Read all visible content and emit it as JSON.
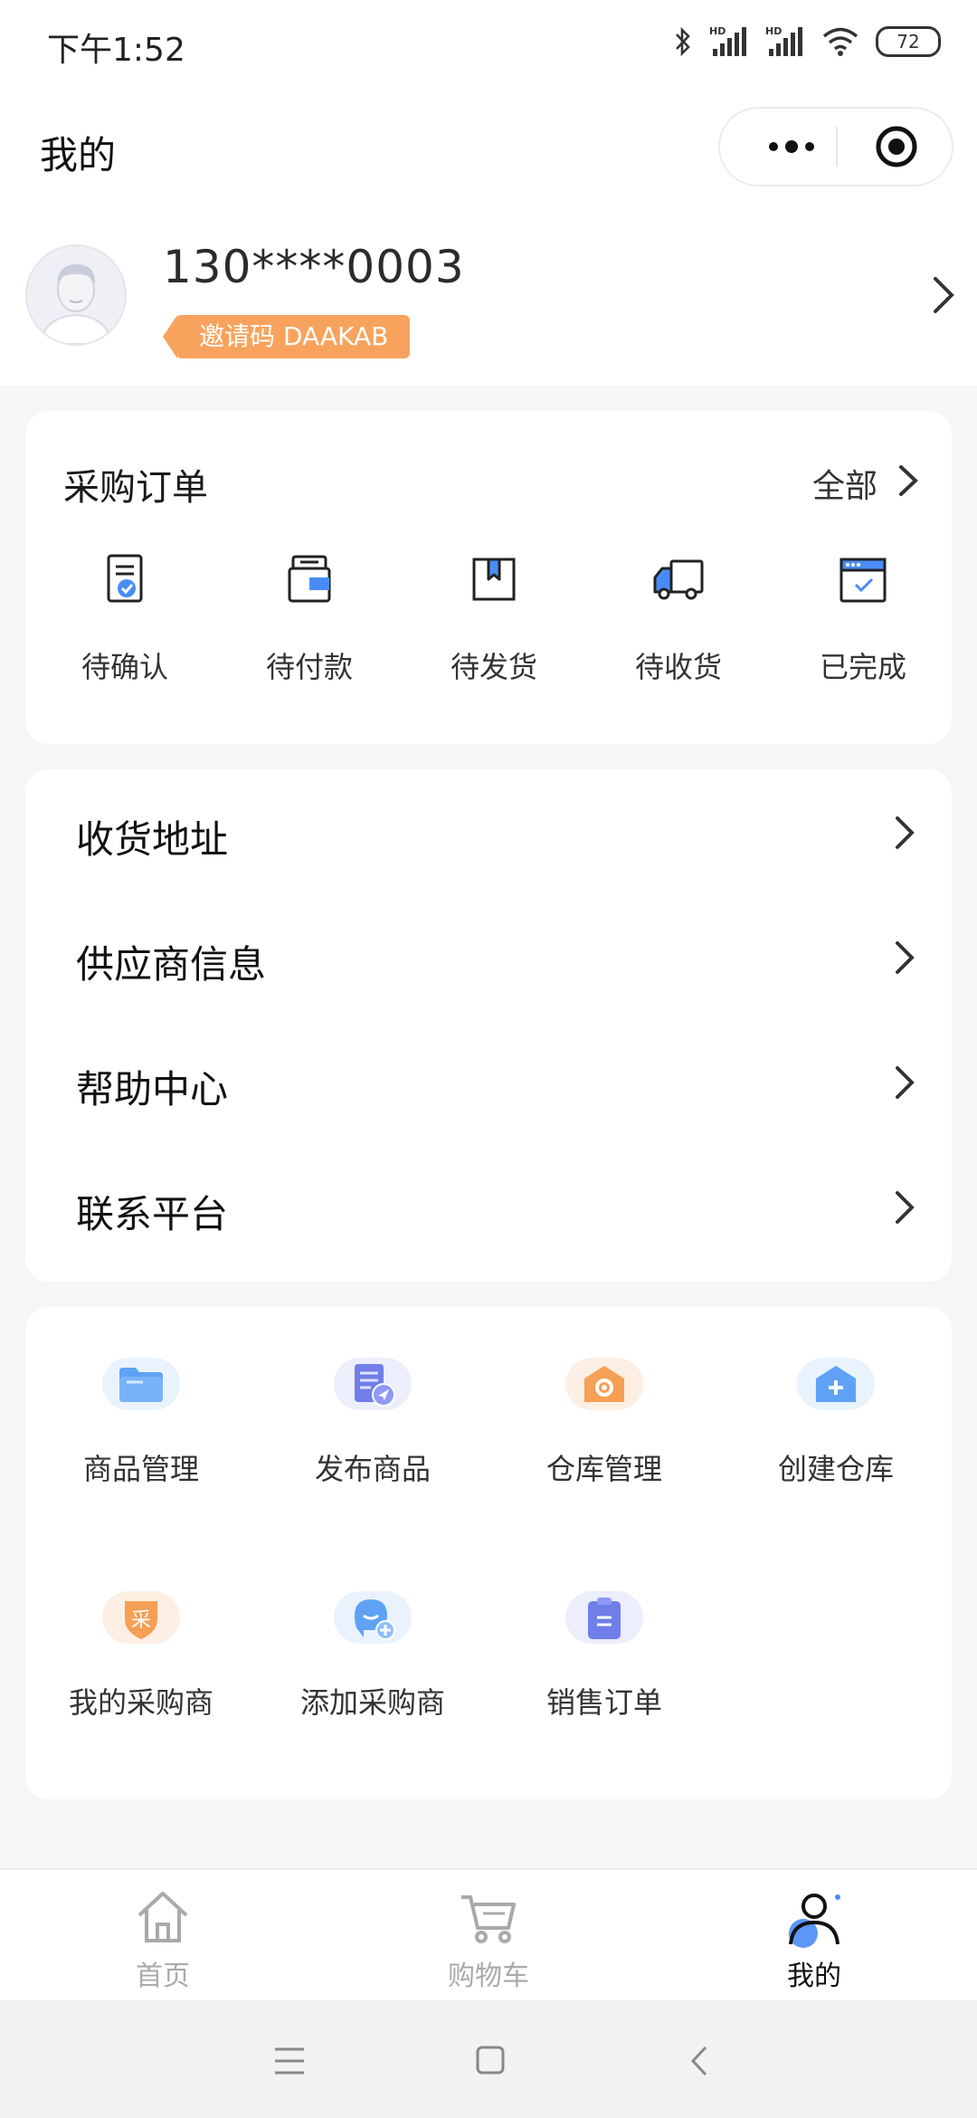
{
  "status_bar": {
    "time": "下午1:52",
    "battery": "72"
  },
  "header": {
    "title": "我的"
  },
  "profile": {
    "phone": "130****0003",
    "invite_code": "邀请码 DAAKAB"
  },
  "orders": {
    "title": "采购订单",
    "all_label": "全部",
    "items": [
      {
        "label": "待确认",
        "icon": "order-confirm-icon"
      },
      {
        "label": "待付款",
        "icon": "wallet-icon"
      },
      {
        "label": "待发货",
        "icon": "package-icon"
      },
      {
        "label": "待收货",
        "icon": "truck-icon"
      },
      {
        "label": "已完成",
        "icon": "completed-icon"
      }
    ]
  },
  "menu": {
    "items": [
      {
        "label": "收货地址"
      },
      {
        "label": "供应商信息"
      },
      {
        "label": "帮助中心"
      },
      {
        "label": "联系平台"
      }
    ]
  },
  "tools": {
    "items": [
      {
        "label": "商品管理",
        "icon": "folder-icon"
      },
      {
        "label": "发布商品",
        "icon": "publish-icon"
      },
      {
        "label": "仓库管理",
        "icon": "warehouse-gear-icon"
      },
      {
        "label": "创建仓库",
        "icon": "warehouse-add-icon"
      },
      {
        "label": "我的采购商",
        "icon": "buyer-shield-icon",
        "badge_char": "采"
      },
      {
        "label": "添加采购商",
        "icon": "add-buyer-icon"
      },
      {
        "label": "销售订单",
        "icon": "clipboard-icon"
      }
    ]
  },
  "tab_bar": {
    "tabs": [
      {
        "label": "首页"
      },
      {
        "label": "购物车"
      },
      {
        "label": "我的"
      }
    ],
    "active": "我的"
  },
  "colors": {
    "accent_blue": "#4a8cf7",
    "invite_orange": "#f8a35d",
    "warehouse_orange": "#f5a054"
  }
}
